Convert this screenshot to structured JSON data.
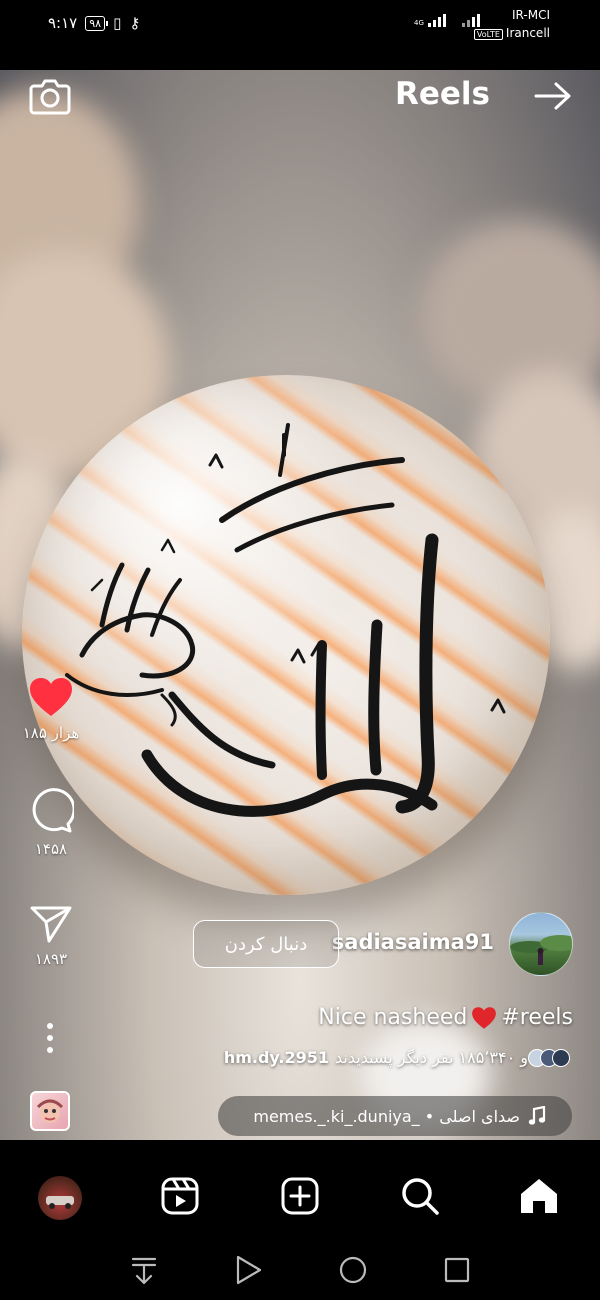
{
  "status_bar": {
    "time": "۹:۱۷",
    "battery": "۹۸",
    "carrier_primary": "IR-MCI",
    "carrier_secondary": "Irancell",
    "volte": "VoLTE",
    "network": "4G"
  },
  "header": {
    "title": "Reels",
    "camera_icon": "camera-icon",
    "forward_icon": "arrow-right-icon"
  },
  "actions": {
    "likes": "۱۸۵ هزار",
    "comments": "۱۴۵۸",
    "shares": "۱۸۹۳"
  },
  "author": {
    "username": "sadiasaima91",
    "follow_label": "دنبال کردن"
  },
  "caption": {
    "text_before": "Nice nasheed",
    "text_after": "#reels"
  },
  "liked_by": {
    "user": "hm.dy.2951",
    "text": "و ۱۸۵٬۳۴۰ نفر دیگر پسندیدند"
  },
  "audio": {
    "label": "memes._.ki_.duniya_ • صدای اصلی"
  },
  "colors": {
    "like_red": "#ff3040",
    "background": "#000000"
  }
}
